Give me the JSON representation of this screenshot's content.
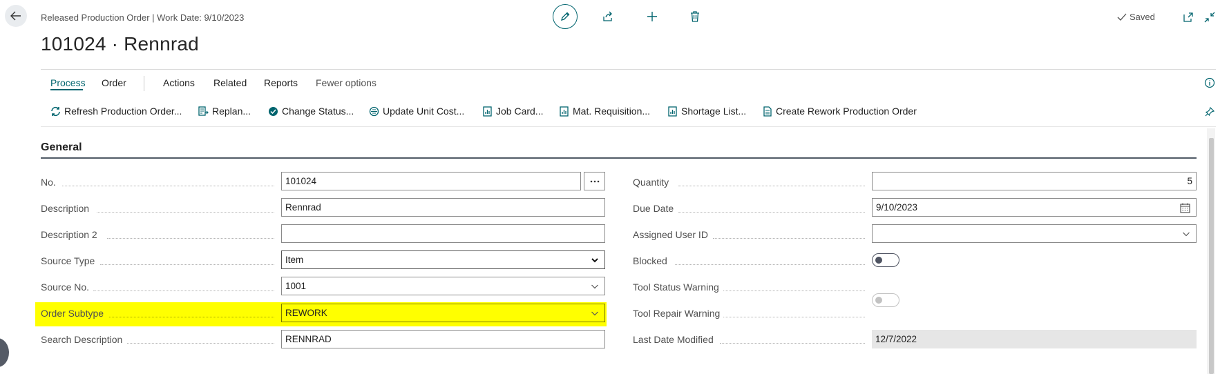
{
  "header": {
    "subtitle": "Released Production Order | Work Date: 9/10/2023",
    "title": "101024 · Rennrad",
    "saved_label": "Saved"
  },
  "tabs": [
    {
      "label": "Process"
    },
    {
      "label": "Order"
    },
    {
      "label": "Actions"
    },
    {
      "label": "Related"
    },
    {
      "label": "Reports"
    },
    {
      "label": "Fewer options"
    }
  ],
  "actions": [
    {
      "label": "Refresh Production Order...",
      "icon": "refresh-icon"
    },
    {
      "label": "Replan...",
      "icon": "replan-icon"
    },
    {
      "label": "Change Status...",
      "icon": "check-circle-icon"
    },
    {
      "label": "Update Unit Cost...",
      "icon": "cost-icon"
    },
    {
      "label": "Job Card...",
      "icon": "report-icon"
    },
    {
      "label": "Mat. Requisition...",
      "icon": "report-icon"
    },
    {
      "label": "Shortage List...",
      "icon": "report-icon"
    },
    {
      "label": "Create Rework Production Order",
      "icon": "document-icon"
    }
  ],
  "section": {
    "title": "General"
  },
  "left_fields": [
    {
      "label": "No.",
      "value": "101024"
    },
    {
      "label": "Description",
      "value": "Rennrad"
    },
    {
      "label": "Description 2",
      "value": ""
    },
    {
      "label": "Source Type",
      "value": "Item"
    },
    {
      "label": "Source No.",
      "value": "1001"
    },
    {
      "label": "Order Subtype",
      "value": "REWORK"
    },
    {
      "label": "Search Description",
      "value": "RENNRAD"
    }
  ],
  "right_fields": [
    {
      "label": "Quantity",
      "value": "5"
    },
    {
      "label": "Due Date",
      "value": "9/10/2023"
    },
    {
      "label": "Assigned User ID",
      "value": ""
    },
    {
      "label": "Blocked",
      "value": false
    },
    {
      "label": "Tool Status Warning",
      "value": false
    },
    {
      "label": "Tool Repair Warning",
      "value": false
    },
    {
      "label": "Last Date Modified",
      "value": "12/7/2022"
    }
  ],
  "colors": {
    "accent": "#00646e",
    "highlight": "#ffff00"
  }
}
